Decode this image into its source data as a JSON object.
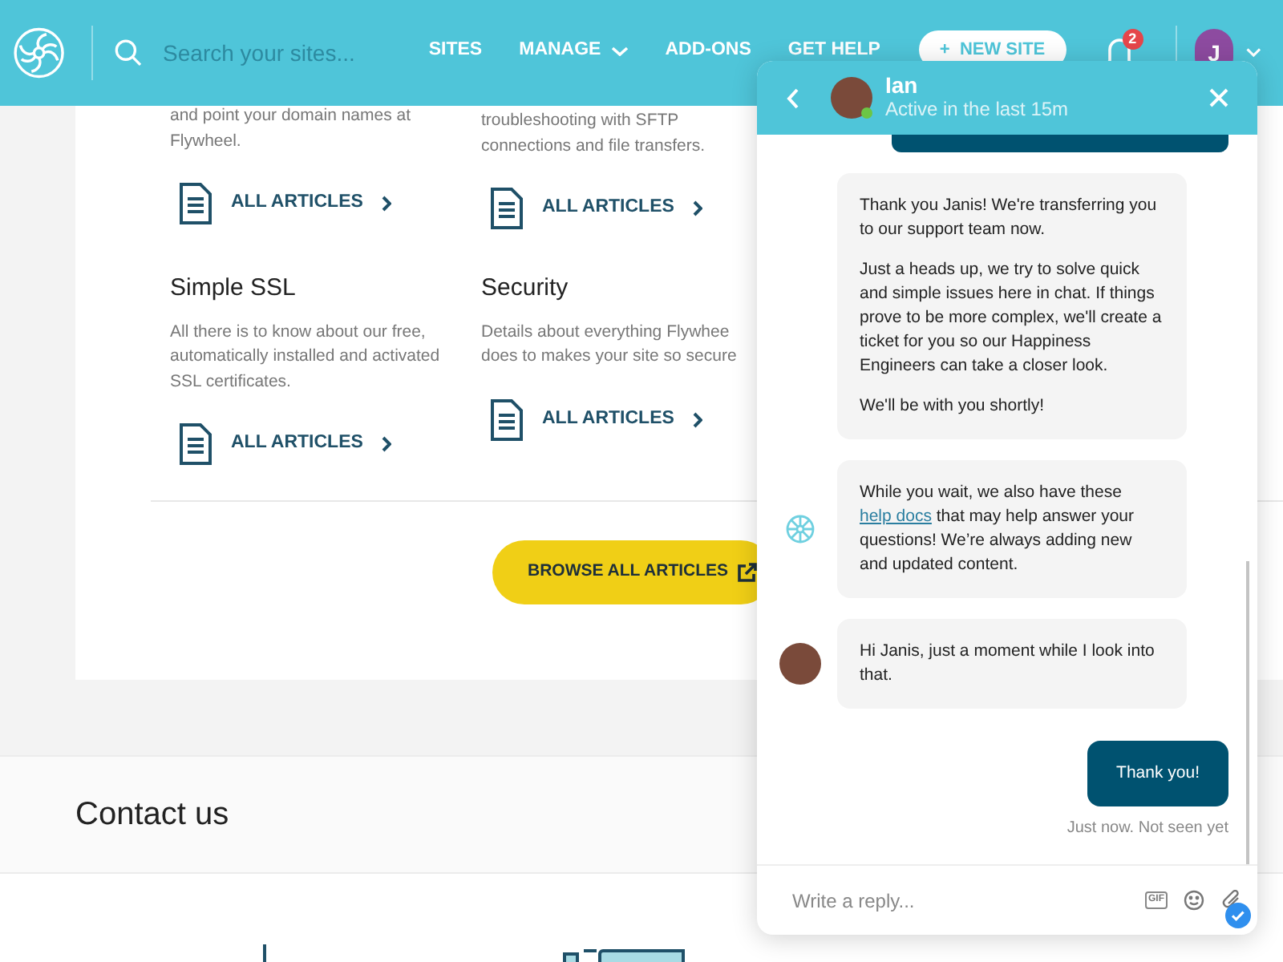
{
  "header": {
    "search_placeholder": "Search your sites...",
    "nav": [
      {
        "label": "SITES",
        "dropdown": false
      },
      {
        "label": "MANAGE",
        "dropdown": true
      },
      {
        "label": "ADD-ONS",
        "dropdown": false
      },
      {
        "label": "GET HELP",
        "dropdown": false
      }
    ],
    "new_site": {
      "icon": "+",
      "label": "NEW SITE"
    },
    "notifications": "2",
    "user_initial": "J"
  },
  "articles": [
    {
      "description": [
        "and point your domain names at",
        "Flywheel."
      ],
      "link": "ALL ARTICLES"
    },
    {
      "description": [
        "troubleshooting with SFTP",
        "connections and file transfers."
      ],
      "link": "ALL ARTICLES"
    },
    {
      "title": "Simple SSL",
      "description": [
        "All there is to know about our free,",
        "automatically installed and activated",
        "SSL certificates."
      ],
      "link": "ALL ARTICLES"
    },
    {
      "title": "Security",
      "description": [
        "Details about everything Flywhee",
        "does to makes your site so secure"
      ],
      "link": "ALL ARTICLES"
    }
  ],
  "browse_button": "BROWSE ALL ARTICLES",
  "contact": {
    "title": "Contact us"
  },
  "chat": {
    "agent": {
      "name": "Ian",
      "status": "Active in the last 15m",
      "online": true
    },
    "messages": [
      {
        "kind": "stub"
      },
      {
        "kind": "plain",
        "paragraphs": [
          [
            {
              "text": "Thank you Janis! We're transferring you to our support team now."
            }
          ],
          [
            {
              "text": "Just a heads up, we try to solve quick and simple issues here in chat. If things prove to be more complex, we'll create a ticket for you so our Happiness Engineers can take a closer look."
            }
          ],
          [
            {
              "text": "We'll be with you shortly!"
            }
          ]
        ]
      },
      {
        "kind": "bot",
        "paragraphs": [
          [
            {
              "text": "While you wait, we also have these "
            },
            {
              "link": "help docs"
            },
            {
              "text": " that may help answer your questions! We’re always adding new and updated content."
            }
          ]
        ]
      },
      {
        "kind": "agent",
        "paragraphs": [
          [
            {
              "text": "Hi Janis, just a moment while I look into that."
            }
          ]
        ]
      },
      {
        "kind": "user",
        "paragraphs": [
          [
            {
              "text": "Thank you!"
            }
          ]
        ],
        "receipt": "Just now. Not seen yet"
      }
    ],
    "reply_placeholder": "Write a reply...",
    "gif_label": "GIF"
  }
}
